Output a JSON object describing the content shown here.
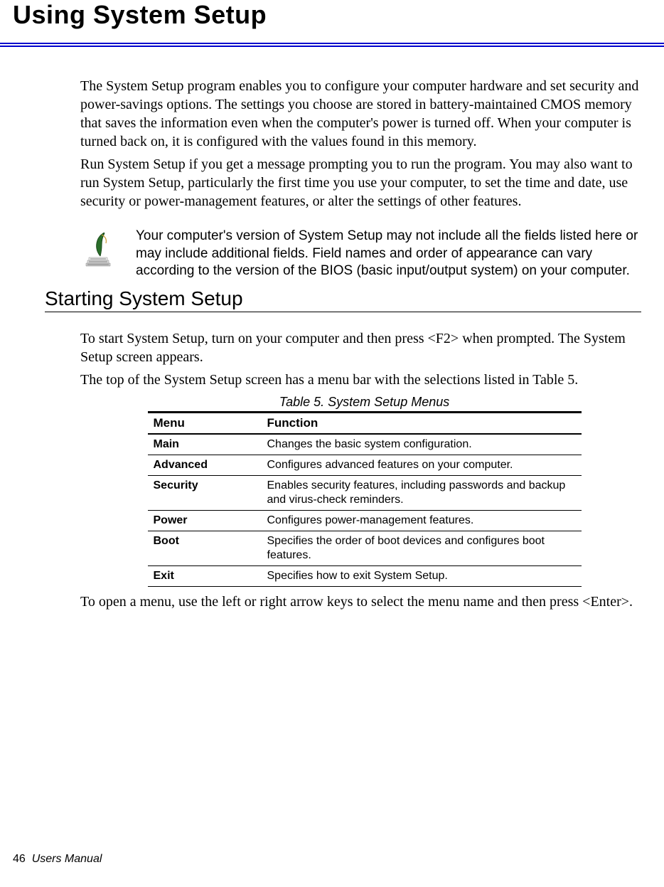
{
  "title": "Using System Setup",
  "para1": "The System Setup program enables you to configure your computer hardware and set security and power-savings options. The settings you choose are stored in battery-maintained CMOS memory that saves the information even when the computer's power is turned off. When your computer is turned back on, it is configured with the values found in this memory.",
  "para2": "Run System Setup if you get a message prompting you to run the program. You may also want to run System Setup, particularly the first time you use your computer, to set the time and date, use security or power-management features, or alter the settings of other features.",
  "note": "Your computer's version of System Setup may not include all the fields listed here or may include additional fields. Field names and order of appearance can vary according to the version of the BIOS (basic input/output system) on your computer.",
  "section_heading": "Starting System Setup",
  "para3": "To start System Setup, turn on your computer and then press <F2> when prompted. The System Setup screen appears.",
  "para4": "The top of the System Setup screen has a menu bar with the selections listed in Table 5.",
  "table_caption": "Table 5.  System Setup Menus",
  "table_headers": {
    "col1": "Menu",
    "col2": "Function"
  },
  "table_rows": [
    {
      "menu": "Main",
      "function": "Changes the basic system configuration."
    },
    {
      "menu": "Advanced",
      "function": "Configures advanced features on your computer."
    },
    {
      "menu": "Security",
      "function": "Enables security features, including passwords and backup and virus-check reminders."
    },
    {
      "menu": "Power",
      "function": "Configures power-management features."
    },
    {
      "menu": "Boot",
      "function": "Specifies the order of boot devices and configures boot features."
    },
    {
      "menu": "Exit",
      "function": "Specifies how to exit System Setup."
    }
  ],
  "para5": "To open a menu, use the left or right arrow keys to select the menu name and then press <Enter>.",
  "footer_page": "46",
  "footer_text": "Users Manual"
}
